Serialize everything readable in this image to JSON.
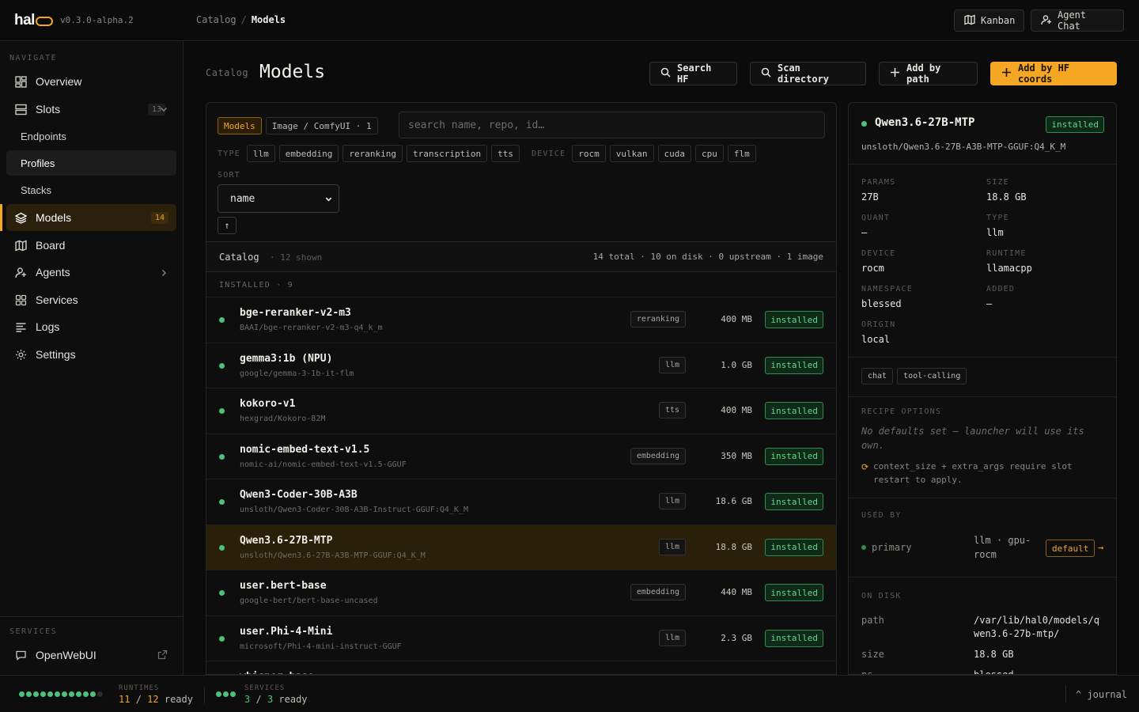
{
  "app": {
    "name": "hal",
    "version": "v0.3.0-alpha.2"
  },
  "breadcrumb": {
    "parent": "Catalog",
    "sep": "/",
    "current": "Models"
  },
  "topbar": {
    "kanban": "Kanban",
    "agent_chat": "Agent Chat"
  },
  "sidebar": {
    "navigate_label": "NAVIGATE",
    "overview": "Overview",
    "slots": "Slots",
    "slots_count": "13",
    "endpoints": "Endpoints",
    "profiles": "Profiles",
    "stacks": "Stacks",
    "models": "Models",
    "models_count": "14",
    "board": "Board",
    "agents": "Agents",
    "services": "Services",
    "logs": "Logs",
    "settings": "Settings",
    "services_label": "SERVICES",
    "openwebui": "OpenWebUI"
  },
  "header": {
    "eyebrow": "Catalog",
    "title": "Models",
    "search_hf": "Search HF",
    "scan_directory": "Scan directory",
    "add_by_path": "Add by path",
    "add_by_hf": "Add by HF coords"
  },
  "filters": {
    "tab_models": "Models",
    "tab_image": "Image / ComfyUI · 1",
    "search_placeholder": "search name, repo, id…",
    "type_label": "TYPE",
    "types": [
      "llm",
      "embedding",
      "reranking",
      "transcription",
      "tts"
    ],
    "device_label": "DEVICE",
    "devices": [
      "rocm",
      "vulkan",
      "cuda",
      "cpu",
      "flm"
    ],
    "sort_label": "SORT",
    "sort_value": "name",
    "sort_dir": "↑"
  },
  "catalog": {
    "label": "Catalog",
    "shown": "· 12 shown",
    "summary": "14 total · 10 on disk · 0 upstream · 1 image",
    "installed_header": "INSTALLED · 9"
  },
  "models": [
    {
      "name": "bge-reranker-v2-m3",
      "repo": "BAAI/bge-reranker-v2-m3-q4_k_m",
      "type": "reranking",
      "size": "400 MB",
      "status": "installed"
    },
    {
      "name": "gemma3:1b (NPU)",
      "repo": "google/gemma-3-1b-it-flm",
      "type": "llm",
      "size": "1.0 GB",
      "status": "installed"
    },
    {
      "name": "kokoro-v1",
      "repo": "hexgrad/Kokoro-82M",
      "type": "tts",
      "size": "400 MB",
      "status": "installed"
    },
    {
      "name": "nomic-embed-text-v1.5",
      "repo": "nomic-ai/nomic-embed-text-v1.5-GGUF",
      "type": "embedding",
      "size": "350 MB",
      "status": "installed"
    },
    {
      "name": "Qwen3-Coder-30B-A3B",
      "repo": "unsloth/Qwen3-Coder-30B-A3B-Instruct-GGUF:Q4_K_M",
      "type": "llm",
      "size": "18.6 GB",
      "status": "installed"
    },
    {
      "name": "Qwen3.6-27B-MTP",
      "repo": "unsloth/Qwen3.6-27B-A3B-MTP-GGUF:Q4_K_M",
      "type": "llm",
      "size": "18.8 GB",
      "status": "installed"
    },
    {
      "name": "user.bert-base",
      "repo": "google-bert/bert-base-uncased",
      "type": "embedding",
      "size": "440 MB",
      "status": "installed"
    },
    {
      "name": "user.Phi-4-Mini",
      "repo": "microsoft/Phi-4-mini-instruct-GGUF",
      "type": "llm",
      "size": "2.3 GB",
      "status": "installed"
    },
    {
      "name": "whisper-base",
      "repo": "",
      "type": "",
      "size": "",
      "status": ""
    }
  ],
  "detail": {
    "name": "Qwen3.6-27B-MTP",
    "status": "installed",
    "repo": "unsloth/Qwen3.6-27B-A3B-MTP-GGUF:Q4_K_M",
    "params_label": "PARAMS",
    "params": "27B",
    "size_label": "SIZE",
    "size": "18.8 GB",
    "quant_label": "QUANT",
    "quant": "—",
    "type_label": "TYPE",
    "type": "llm",
    "device_label": "DEVICE",
    "device": "rocm",
    "runtime_label": "RUNTIME",
    "runtime": "llamacpp",
    "namespace_label": "NAMESPACE",
    "namespace": "blessed",
    "added_label": "ADDED",
    "added": "—",
    "origin_label": "ORIGIN",
    "origin": "local",
    "tags": [
      "chat",
      "tool-calling"
    ],
    "recipe_label": "RECIPE OPTIONS",
    "recipe_note": "No defaults set — launcher will use its own.",
    "recipe_warn": "context_size + extra_args require slot restart to apply.",
    "used_by_label": "USED BY",
    "used_slot": "primary",
    "used_runtime": "llm · gpu-rocm",
    "used_badge": "default",
    "used_arrow": "→",
    "on_disk_label": "ON DISK",
    "path_label": "path",
    "path": "/var/lib/hal0/models/qwen3.6-27b-mtp/",
    "disk_size_label": "size",
    "disk_size": "18.8 GB",
    "ns_label": "ns",
    "ns": "blessed"
  },
  "status": {
    "runtimes_label": "RUNTIMES",
    "runtimes_ready": "11",
    "runtimes_sep": "/",
    "runtimes_total": "12",
    "runtimes_suffix": "ready",
    "services_label": "SERVICES",
    "services_ready": "3",
    "services_sep": "/",
    "services_total": "3",
    "services_suffix": "ready",
    "journal": "^ journal"
  },
  "colors": {
    "accent": "#f5a623",
    "ready": "#4cc27a",
    "bg": "#0b0b0b"
  }
}
